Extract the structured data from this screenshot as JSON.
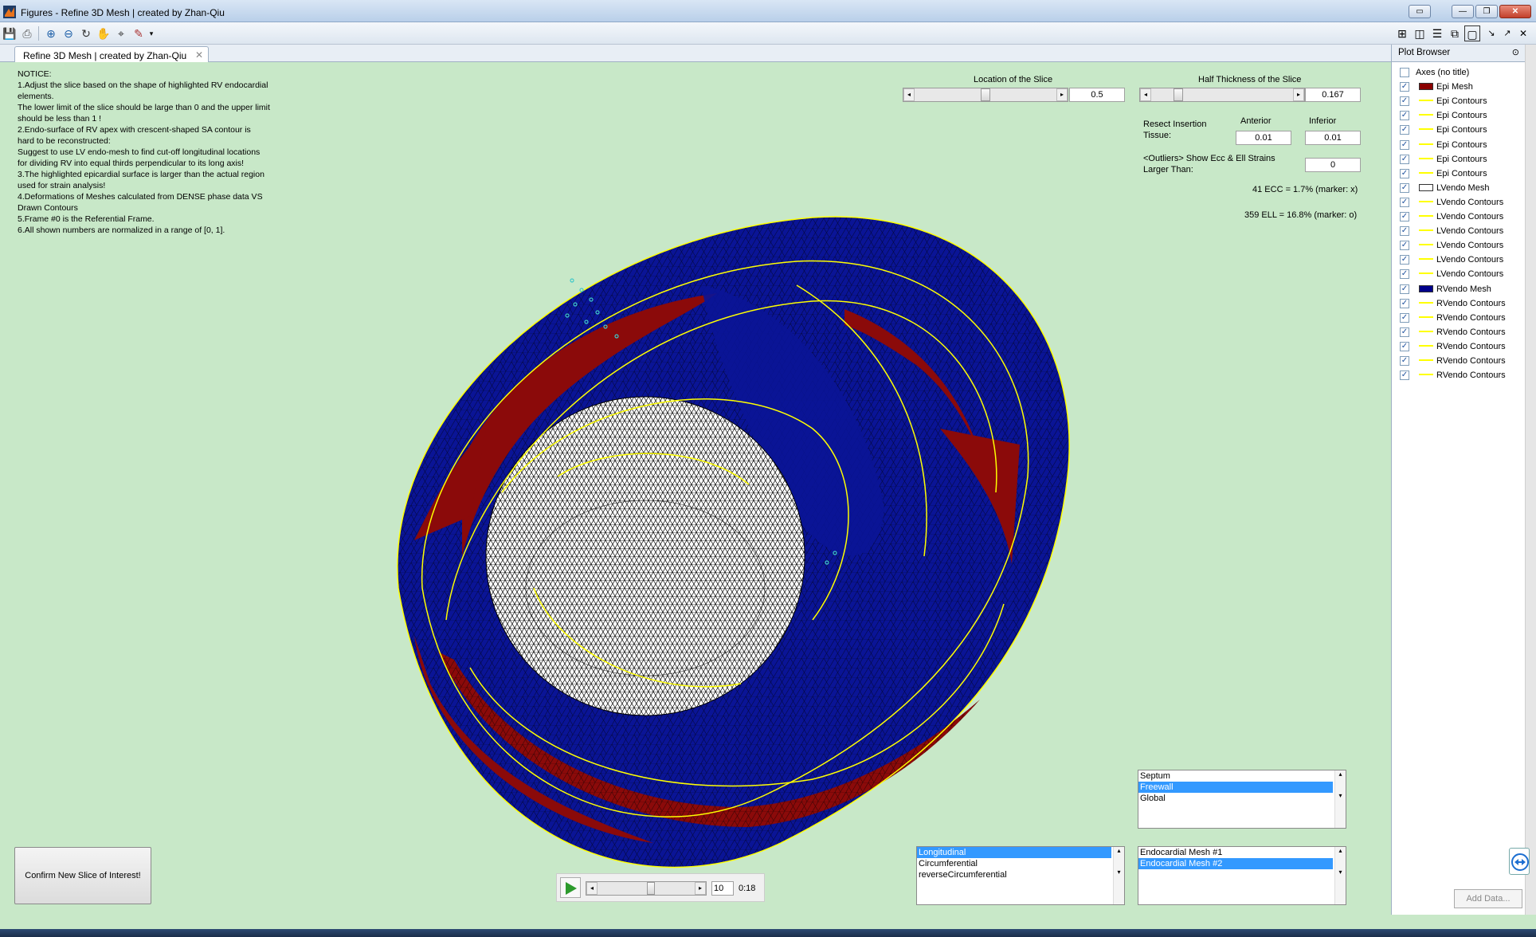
{
  "window": {
    "title": "Figures - Refine 3D Mesh | created by Zhan-Qiu",
    "tab_label": "Refine 3D Mesh | created by Zhan-Qiu"
  },
  "notice": {
    "lines": [
      "NOTICE:",
      "1.Adjust the slice based on the shape of highlighted RV endocardial",
      "elements.",
      "The lower limit of the slice should be large than 0 and the upper limit",
      "should be less than 1 !",
      "2.Endo-surface of RV apex with crescent-shaped SA contour is",
      "hard to be reconstructed:",
      "Suggest to use LV endo-mesh to find cut-off longitudinal locations",
      "for dividing RV into equal thirds perpendicular to its long axis!",
      "3.The highlighted epicardial surface is larger than the actual region",
      "used for strain analysis!",
      "4.Deformations of Meshes calculated from DENSE phase data VS",
      "Drawn Contours",
      "5.Frame #0 is the Referential Frame.",
      "6.All shown numbers are normalized in a range of [0, 1]."
    ]
  },
  "controls": {
    "location_label": "Location of the Slice",
    "location_value": "0.5",
    "location_fraction": 0.5,
    "thickness_label": "Half Thickness of the Slice",
    "thickness_value": "0.167",
    "thickness_fraction": 0.167,
    "resect_label_1": "Resect Insertion",
    "resect_label_2": "Tissue:",
    "anterior_label": "Anterior",
    "inferior_label": "Inferior",
    "anterior_value": "0.01",
    "inferior_value": "0.01",
    "outliers_label_1": "<Outliers> Show Ecc & Ell Strains",
    "outliers_label_2": "Larger Than:",
    "outliers_value": "0",
    "ecc_text": "41 ECC = 1.7% (marker: x)",
    "ell_text": "359 ELL = 16.8% (marker: o)"
  },
  "region_list": {
    "items": [
      "Septum",
      "Freewall",
      "Global"
    ],
    "selected": 1
  },
  "strain_list": {
    "items": [
      "Longitudinal",
      "Circumferential",
      "reverseCircumferential"
    ],
    "selected": 0
  },
  "mesh_list": {
    "items": [
      "Endocardial Mesh #1",
      "Endocardial Mesh #2"
    ],
    "selected": 1
  },
  "confirm_button": "Confirm New Slice of Interest!",
  "player": {
    "frame": "10",
    "time": "0:18",
    "progress": 0.55
  },
  "plot_browser": {
    "title": "Plot Browser",
    "items": [
      {
        "label": "Axes (no title)",
        "checked": false,
        "swatch": "none",
        "color": ""
      },
      {
        "label": "Epi Mesh",
        "checked": true,
        "swatch": "patch",
        "color": "#8b0000"
      },
      {
        "label": "Epi Contours",
        "checked": true,
        "swatch": "line",
        "color": "#ffff00"
      },
      {
        "label": "Epi Contours",
        "checked": true,
        "swatch": "line",
        "color": "#ffff00"
      },
      {
        "label": "Epi Contours",
        "checked": true,
        "swatch": "line",
        "color": "#ffff00"
      },
      {
        "label": "Epi Contours",
        "checked": true,
        "swatch": "line",
        "color": "#ffff00"
      },
      {
        "label": "Epi Contours",
        "checked": true,
        "swatch": "line",
        "color": "#ffff00"
      },
      {
        "label": "Epi Contours",
        "checked": true,
        "swatch": "line",
        "color": "#ffff00"
      },
      {
        "label": "LVendo Mesh",
        "checked": true,
        "swatch": "patch",
        "color": "#ffffff"
      },
      {
        "label": "LVendo Contours",
        "checked": true,
        "swatch": "line",
        "color": "#ffff00"
      },
      {
        "label": "LVendo Contours",
        "checked": true,
        "swatch": "line",
        "color": "#ffff00"
      },
      {
        "label": "LVendo Contours",
        "checked": true,
        "swatch": "line",
        "color": "#ffff00"
      },
      {
        "label": "LVendo Contours",
        "checked": true,
        "swatch": "line",
        "color": "#ffff00"
      },
      {
        "label": "LVendo Contours",
        "checked": true,
        "swatch": "line",
        "color": "#ffff00"
      },
      {
        "label": "LVendo Contours",
        "checked": true,
        "swatch": "line",
        "color": "#ffff00"
      },
      {
        "label": "RVendo Mesh",
        "checked": true,
        "swatch": "patch",
        "color": "#00008b"
      },
      {
        "label": "RVendo Contours",
        "checked": true,
        "swatch": "line",
        "color": "#ffff00"
      },
      {
        "label": "RVendo Contours",
        "checked": true,
        "swatch": "line",
        "color": "#ffff00"
      },
      {
        "label": "RVendo Contours",
        "checked": true,
        "swatch": "line",
        "color": "#ffff00"
      },
      {
        "label": "RVendo Contours",
        "checked": true,
        "swatch": "line",
        "color": "#ffff00"
      },
      {
        "label": "RVendo Contours",
        "checked": true,
        "swatch": "line",
        "color": "#ffff00"
      },
      {
        "label": "RVendo Contours",
        "checked": true,
        "swatch": "line",
        "color": "#ffff00"
      }
    ],
    "add_data": "Add Data..."
  },
  "colors": {
    "figure_bg": "#c8e8c8",
    "epi": "#8b0000",
    "rv": "#00008b",
    "lv": "#ffffff",
    "contour": "#ffff00"
  }
}
